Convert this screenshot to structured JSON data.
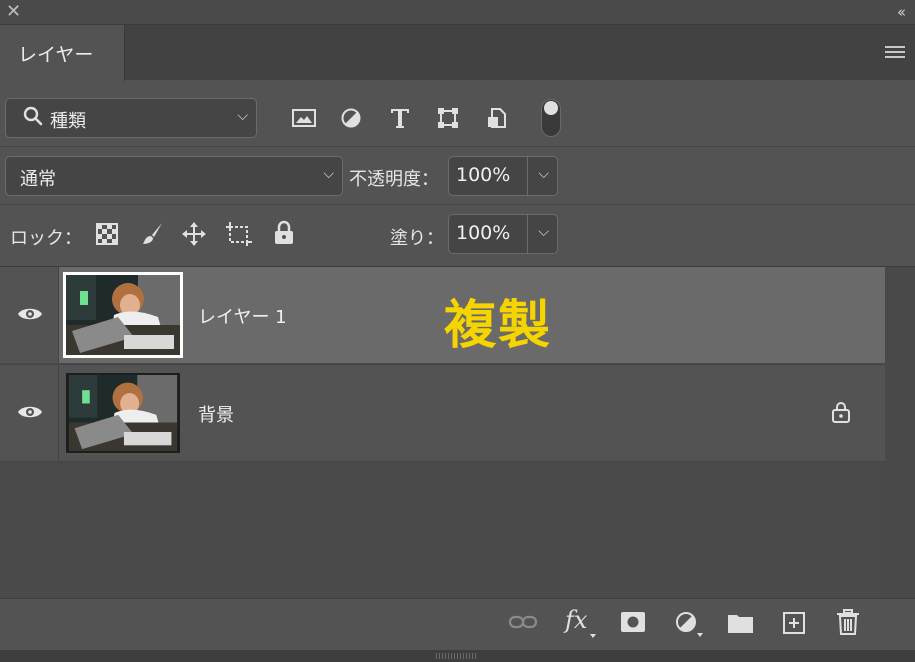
{
  "header": {
    "close_glyph": "✕",
    "collapse_glyph": "‹‹"
  },
  "tabs": [
    {
      "label": "レイヤー",
      "active": true
    }
  ],
  "filter": {
    "selected": "種類",
    "icons": [
      "image-filter-icon",
      "adjustment-filter-icon",
      "type-filter-icon",
      "shape-filter-icon",
      "smart-object-filter-icon",
      "filter-toggle-icon"
    ]
  },
  "blend": {
    "mode": "通常",
    "opacity_label": "不透明度：",
    "opacity_value": "100%"
  },
  "lock": {
    "label": "ロック：",
    "fill_label": "塗り：",
    "fill_value": "100%",
    "icons": [
      "lock-transparent-pixels-icon",
      "lock-image-pixels-icon",
      "lock-position-icon",
      "lock-artboard-icon",
      "lock-all-icon"
    ]
  },
  "layers": [
    {
      "name": "レイヤー 1",
      "selected": true,
      "visible": true,
      "locked": false
    },
    {
      "name": "背景",
      "selected": false,
      "visible": true,
      "locked": true
    }
  ],
  "annotation": {
    "text": "複製",
    "color": "#f5d400"
  },
  "footer": {
    "icons": [
      "link-layers-icon",
      "fx-icon",
      "layer-mask-icon",
      "adjustment-layer-icon",
      "new-group-icon",
      "new-layer-icon",
      "delete-layer-icon"
    ],
    "fx_label": "fx"
  }
}
